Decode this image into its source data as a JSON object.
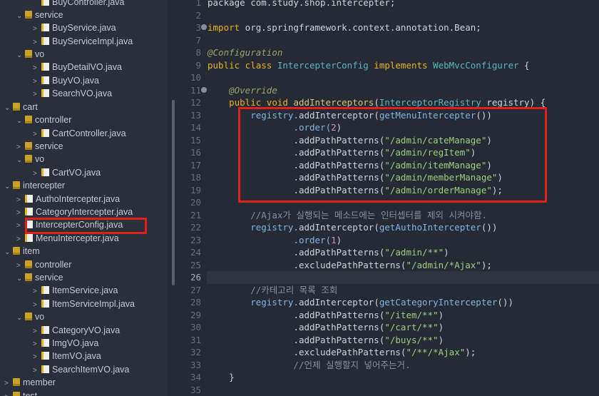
{
  "tree": [
    {
      "label": "BuyController.java",
      "kind": "java",
      "chev": ""
    },
    {
      "label": "service",
      "kind": "pkg",
      "chev": "⌄"
    },
    {
      "label": "BuyService.java",
      "kind": "java",
      "chev": ">"
    },
    {
      "label": "BuyServiceImpl.java",
      "kind": "java",
      "chev": ">"
    },
    {
      "label": "vo",
      "kind": "pkg",
      "chev": "⌄"
    },
    {
      "label": "BuyDetailVO.java",
      "kind": "java",
      "chev": ">"
    },
    {
      "label": "BuyVO.java",
      "kind": "java",
      "chev": ">"
    },
    {
      "label": "SearchVO.java",
      "kind": "java",
      "chev": ">"
    },
    {
      "label": "cart",
      "kind": "pkg",
      "chev": "⌄"
    },
    {
      "label": "controller",
      "kind": "pkg",
      "chev": "⌄"
    },
    {
      "label": "CartController.java",
      "kind": "java",
      "chev": ">"
    },
    {
      "label": "service",
      "kind": "pkg",
      "chev": ">"
    },
    {
      "label": "vo",
      "kind": "pkg",
      "chev": "⌄"
    },
    {
      "label": "CartVO.java",
      "kind": "java",
      "chev": ">"
    },
    {
      "label": "intercepter",
      "kind": "pkg",
      "chev": "⌄"
    },
    {
      "label": "AuthoIntercepter.java",
      "kind": "java",
      "chev": ">"
    },
    {
      "label": "CategoryIntercepter.java",
      "kind": "java",
      "chev": ">"
    },
    {
      "label": "IntercepterConfig.java",
      "kind": "java",
      "chev": ">"
    },
    {
      "label": "MenuIntercepter.java",
      "kind": "java",
      "chev": ">"
    },
    {
      "label": "item",
      "kind": "pkg",
      "chev": "⌄"
    },
    {
      "label": "controller",
      "kind": "pkg",
      "chev": ">"
    },
    {
      "label": "service",
      "kind": "pkg",
      "chev": "⌄"
    },
    {
      "label": "ItemService.java",
      "kind": "java",
      "chev": ">"
    },
    {
      "label": "ItemServiceImpl.java",
      "kind": "java",
      "chev": ">"
    },
    {
      "label": "vo",
      "kind": "pkg",
      "chev": "⌄"
    },
    {
      "label": "CategoryVO.java",
      "kind": "java",
      "chev": ">"
    },
    {
      "label": "ImgVO.java",
      "kind": "java",
      "chev": ">"
    },
    {
      "label": "ItemVO.java",
      "kind": "java",
      "chev": ">"
    },
    {
      "label": "SearchItemVO.java",
      "kind": "java",
      "chev": ">"
    },
    {
      "label": "member",
      "kind": "pkg",
      "chev": ">"
    },
    {
      "label": "test",
      "kind": "pkg",
      "chev": ">"
    }
  ],
  "line_numbers": [
    "1",
    "2",
    "3",
    "7",
    "8",
    "9",
    "10",
    "11",
    "12",
    "13",
    "14",
    "15",
    "16",
    "17",
    "18",
    "19",
    "20",
    "21",
    "22",
    "23",
    "24",
    "25",
    "26",
    "27",
    "28",
    "29",
    "30",
    "31",
    "32",
    "33",
    "34",
    "35"
  ],
  "code": {
    "l1": "package com.study.shop.intercepter;",
    "l3_kw": "import",
    "l3_rest": " org.springframework.context.annotation.Bean;",
    "l8": "@Configuration",
    "l9_a": "public class ",
    "l9_b": "IntercepterConfig",
    "l9_c": " implements ",
    "l9_d": "WebMvcConfigurer",
    "l9_e": " {",
    "l11": "@Override",
    "l12_a": "public void ",
    "l12_b": "addInterceptors",
    "l12_c": "(",
    "l12_d": "InterceptorRegistry",
    "l12_e": " registry) {",
    "l13_a": "registry.",
    "l13_b": "addInterceptor",
    "l13_c": "(",
    "l13_d": "getMenuIntercepter",
    "l13_e": "())",
    "l14_a": ".order(",
    "l14_b": "2",
    "l14_c": ")",
    "p_method": ".addPathPatterns(",
    "l15": "\"/admin/cateManage\"",
    "l16": "\"/admin/regItem\"",
    "l17": "\"/admin/itemManage\"",
    "l18": "\"/admin/memberManage\"",
    "l19": "\"/admin/orderManage\"",
    "l22": "//Ajax가 실행되는 메소드에는 인터셉터를 제외 시켜야함.",
    "l23_d": "getAuthoIntercepter",
    "l24_b": "1",
    "l25_s": "\"/admin/**\"",
    "l26_a": ".excludePathPatterns(",
    "l26_s": "\"/admin/*Ajax\"",
    "l28": "//카테고리 목록 조회",
    "l29_d": "getCategoryIntercepter",
    "l30": "\"/item/**\"",
    "l31": "\"/cart/**\"",
    "l32": "\"/buys/**\"",
    "l33_s": "\"/**/*Ajax\"",
    "l34": "//언제 실행할지 넣어주는거.",
    "l35": "}"
  }
}
